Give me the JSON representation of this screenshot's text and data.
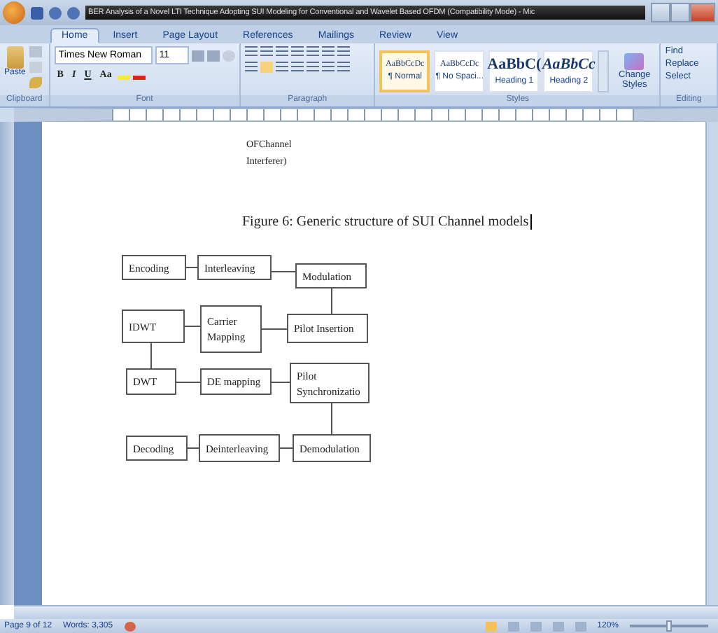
{
  "window": {
    "title": "BER Analysis of a Novel LTI Technique Adopting SUI Modeling for Conventional and Wavelet Based OFDM (Compatibility Mode) - Mic"
  },
  "tabs": [
    {
      "label": "Home",
      "selected": true
    },
    {
      "label": "Insert",
      "selected": false
    },
    {
      "label": "Page Layout",
      "selected": false
    },
    {
      "label": "References",
      "selected": false
    },
    {
      "label": "Mailings",
      "selected": false
    },
    {
      "label": "Review",
      "selected": false
    },
    {
      "label": "View",
      "selected": false
    }
  ],
  "ribbon": {
    "paste": "Paste",
    "font_name": "Times New Roman",
    "font_size": "11",
    "font_buttons": [
      "B",
      "I",
      "U",
      "Aa"
    ],
    "styles": [
      {
        "preview": "AaBbCcDc",
        "name": "¶ Normal",
        "selected": true
      },
      {
        "preview": "AaBbCcDc",
        "name": "¶ No Spaci...",
        "selected": false
      },
      {
        "preview": "AaBbC(",
        "name": "Heading 1",
        "selected": false
      },
      {
        "preview": "AaBbCc",
        "name": "Heading 2",
        "selected": false
      }
    ],
    "change_styles": "Change Styles",
    "editing": [
      "Find",
      "Replace",
      "Select"
    ],
    "group_labels": [
      "Clipboard",
      "Font",
      "Paragraph",
      "Styles",
      "Editing"
    ]
  },
  "document": {
    "fragment": [
      "OFChannel",
      "Interferer)"
    ],
    "caption": "Figure 6: Generic structure of SUI Channel models",
    "blocks": [
      {
        "label": "Encoding"
      },
      {
        "label": "Interleaving"
      },
      {
        "label": "Modulation"
      },
      {
        "label": "IDWT"
      },
      {
        "label": "Carrier Mapping"
      },
      {
        "label": "Pilot Insertion"
      },
      {
        "label": "DWT"
      },
      {
        "label": "DE mapping"
      },
      {
        "label": "Pilot Synchronizatio"
      },
      {
        "label": "Decoding"
      },
      {
        "label": "Deinterleaving"
      },
      {
        "label": "Demodulation"
      }
    ]
  },
  "status_bar": {
    "page": "Page 9 of 12",
    "words": "Words: 3,305",
    "zoom": "120%",
    "zoom_slider": {
      "level": 0.5
    }
  }
}
